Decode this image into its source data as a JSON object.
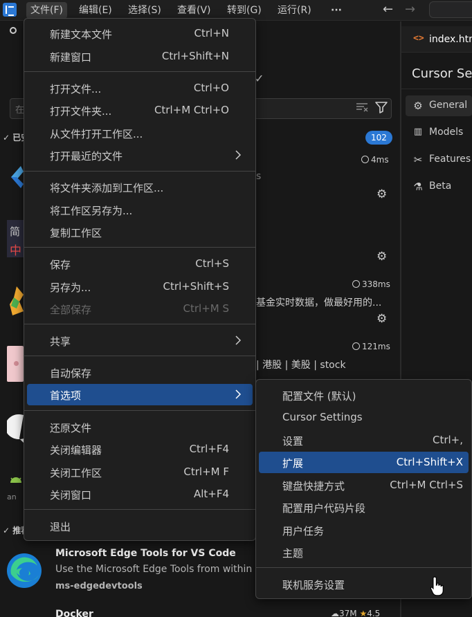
{
  "menubar": {
    "items": [
      "文件(F)",
      "编辑(E)",
      "选择(S)",
      "查看(V)",
      "转到(G)",
      "运行(R)"
    ],
    "more": "···",
    "back_arrow": "←",
    "forward_arrow": "→"
  },
  "sidebar": {
    "search_hint": "在",
    "section_installed": "已安",
    "installed_count": "102",
    "section_recommended": "推荐",
    "items": [
      {
        "time": "4ms",
        "frag": "s"
      },
      {
        "icon_text_top": "简",
        "icon_text_bottom": "中"
      },
      {
        "time": "338ms",
        "frag": "基金实时数据，做最好用的..."
      },
      {
        "time": "121ms",
        "frag": "| 港股 | 美股 | stock"
      }
    ],
    "android_label": "an",
    "edge_ext": {
      "title": "Microsoft Edge Tools for VS Code",
      "desc": "Use the Microsoft Edge Tools from within",
      "publisher": "ms-edgedevtools"
    },
    "docker_ext": {
      "title": "Docker",
      "downloads": "37M",
      "rating": "4.5"
    }
  },
  "editor": {
    "tab_icon": "<>",
    "tab_label": "index.htm",
    "settings_title": "Cursor Se",
    "settings_nav": [
      {
        "icon": "gear-icon",
        "label": "General"
      },
      {
        "icon": "chart-icon",
        "label": "Models"
      },
      {
        "icon": "tools-icon",
        "label": "Features"
      },
      {
        "icon": "flask-icon",
        "label": "Beta"
      }
    ]
  },
  "file_menu": {
    "groups": [
      [
        {
          "label": "新建文本文件",
          "key": "Ctrl+N"
        },
        {
          "label": "新建窗口",
          "key": "Ctrl+Shift+N"
        }
      ],
      [
        {
          "label": "打开文件...",
          "key": "Ctrl+O"
        },
        {
          "label": "打开文件夹...",
          "key": "Ctrl+M Ctrl+O"
        },
        {
          "label": "从文件打开工作区...",
          "key": ""
        },
        {
          "label": "打开最近的文件",
          "key": "",
          "submenu": true
        }
      ],
      [
        {
          "label": "将文件夹添加到工作区...",
          "key": ""
        },
        {
          "label": "将工作区另存为...",
          "key": ""
        },
        {
          "label": "复制工作区",
          "key": ""
        }
      ],
      [
        {
          "label": "保存",
          "key": "Ctrl+S"
        },
        {
          "label": "另存为...",
          "key": "Ctrl+Shift+S"
        },
        {
          "label": "全部保存",
          "key": "Ctrl+M S",
          "disabled": true
        }
      ],
      [
        {
          "label": "共享",
          "key": "",
          "submenu": true
        }
      ],
      [
        {
          "label": "自动保存",
          "key": ""
        },
        {
          "label": "首选项",
          "key": "",
          "submenu": true,
          "active": true
        }
      ],
      [
        {
          "label": "还原文件",
          "key": ""
        },
        {
          "label": "关闭编辑器",
          "key": "Ctrl+F4"
        },
        {
          "label": "关闭工作区",
          "key": "Ctrl+M F"
        },
        {
          "label": "关闭窗口",
          "key": "Alt+F4"
        }
      ],
      [
        {
          "label": "退出",
          "key": ""
        }
      ]
    ]
  },
  "pref_menu": {
    "groups": [
      [
        {
          "label": "配置文件 (默认)",
          "key": ""
        },
        {
          "label": "Cursor Settings",
          "key": ""
        },
        {
          "label": "设置",
          "key": "Ctrl+,"
        },
        {
          "label": "扩展",
          "key": "Ctrl+Shift+X",
          "active": true
        },
        {
          "label": "键盘快捷方式",
          "key": "Ctrl+M Ctrl+S"
        },
        {
          "label": "配置用户代码片段",
          "key": ""
        },
        {
          "label": "用户任务",
          "key": ""
        },
        {
          "label": "主题",
          "key": ""
        }
      ],
      [
        {
          "label": "联机服务设置",
          "key": ""
        }
      ]
    ]
  },
  "colors": {
    "accent": "#2b78d4",
    "menu_highlight": "#1f4e8f",
    "menu_bg": "#1f1f1f",
    "page_bg": "#181818"
  }
}
